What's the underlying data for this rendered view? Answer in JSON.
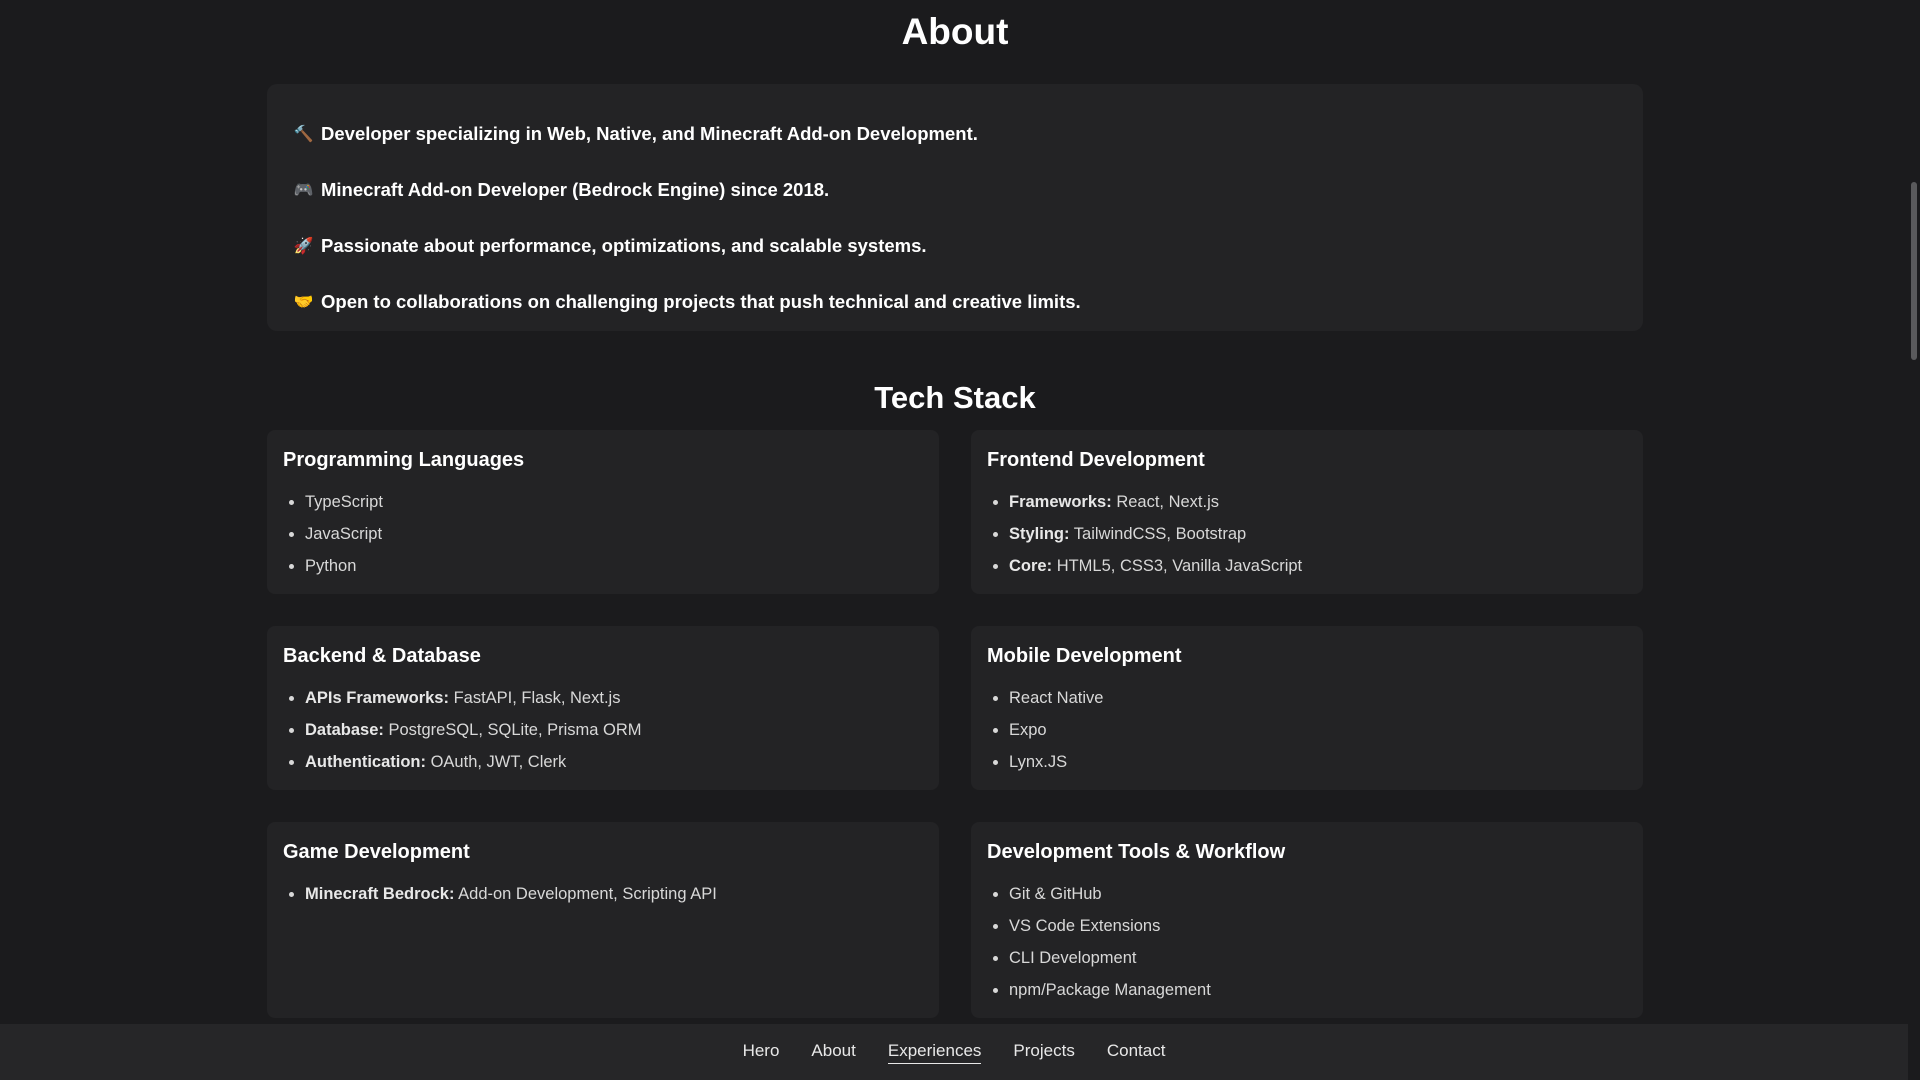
{
  "about": {
    "title": "About",
    "lines": [
      {
        "icon": "hammer-icon",
        "glyph": "🔨",
        "text": "Developer specializing in Web, Native, and Minecraft Add-on Development."
      },
      {
        "icon": "gamepad-icon",
        "glyph": "🎮",
        "text": "Minecraft Add-on Developer (Bedrock Engine) since 2018."
      },
      {
        "icon": "rocket-icon",
        "glyph": "🚀",
        "text": "Passionate about performance, optimizations, and scalable systems."
      },
      {
        "icon": "handshake-icon",
        "glyph": "🤝",
        "text": "Open to collaborations on challenging projects that push technical and creative limits."
      }
    ]
  },
  "tech": {
    "title": "Tech Stack",
    "cards": [
      {
        "title": "Programming Languages",
        "items": [
          {
            "label": "",
            "value": "TypeScript"
          },
          {
            "label": "",
            "value": "JavaScript"
          },
          {
            "label": "",
            "value": "Python"
          }
        ]
      },
      {
        "title": "Frontend Development",
        "items": [
          {
            "label": "Frameworks:",
            "value": "React, Next.js"
          },
          {
            "label": "Styling:",
            "value": "TailwindCSS, Bootstrap"
          },
          {
            "label": "Core:",
            "value": "HTML5, CSS3, Vanilla JavaScript"
          }
        ]
      },
      {
        "title": "Backend & Database",
        "items": [
          {
            "label": "APIs Frameworks:",
            "value": "FastAPI, Flask, Next.js"
          },
          {
            "label": "Database:",
            "value": "PostgreSQL, SQLite, Prisma ORM"
          },
          {
            "label": "Authentication:",
            "value": "OAuth, JWT, Clerk"
          }
        ]
      },
      {
        "title": "Mobile Development",
        "items": [
          {
            "label": "",
            "value": "React Native"
          },
          {
            "label": "",
            "value": "Expo"
          },
          {
            "label": "",
            "value": "Lynx.JS"
          }
        ]
      },
      {
        "title": "Game Development",
        "items": [
          {
            "label": "Minecraft Bedrock:",
            "value": "Add-on Development, Scripting API"
          }
        ]
      },
      {
        "title": "Development Tools & Workflow",
        "items": [
          {
            "label": "",
            "value": "Git & GitHub"
          },
          {
            "label": "",
            "value": "VS Code Extensions"
          },
          {
            "label": "",
            "value": "CLI Development"
          },
          {
            "label": "",
            "value": "npm/Package Management"
          }
        ]
      }
    ]
  },
  "nav": {
    "items": [
      "Hero",
      "About",
      "Experiences",
      "Projects",
      "Contact"
    ],
    "active": "Experiences"
  }
}
